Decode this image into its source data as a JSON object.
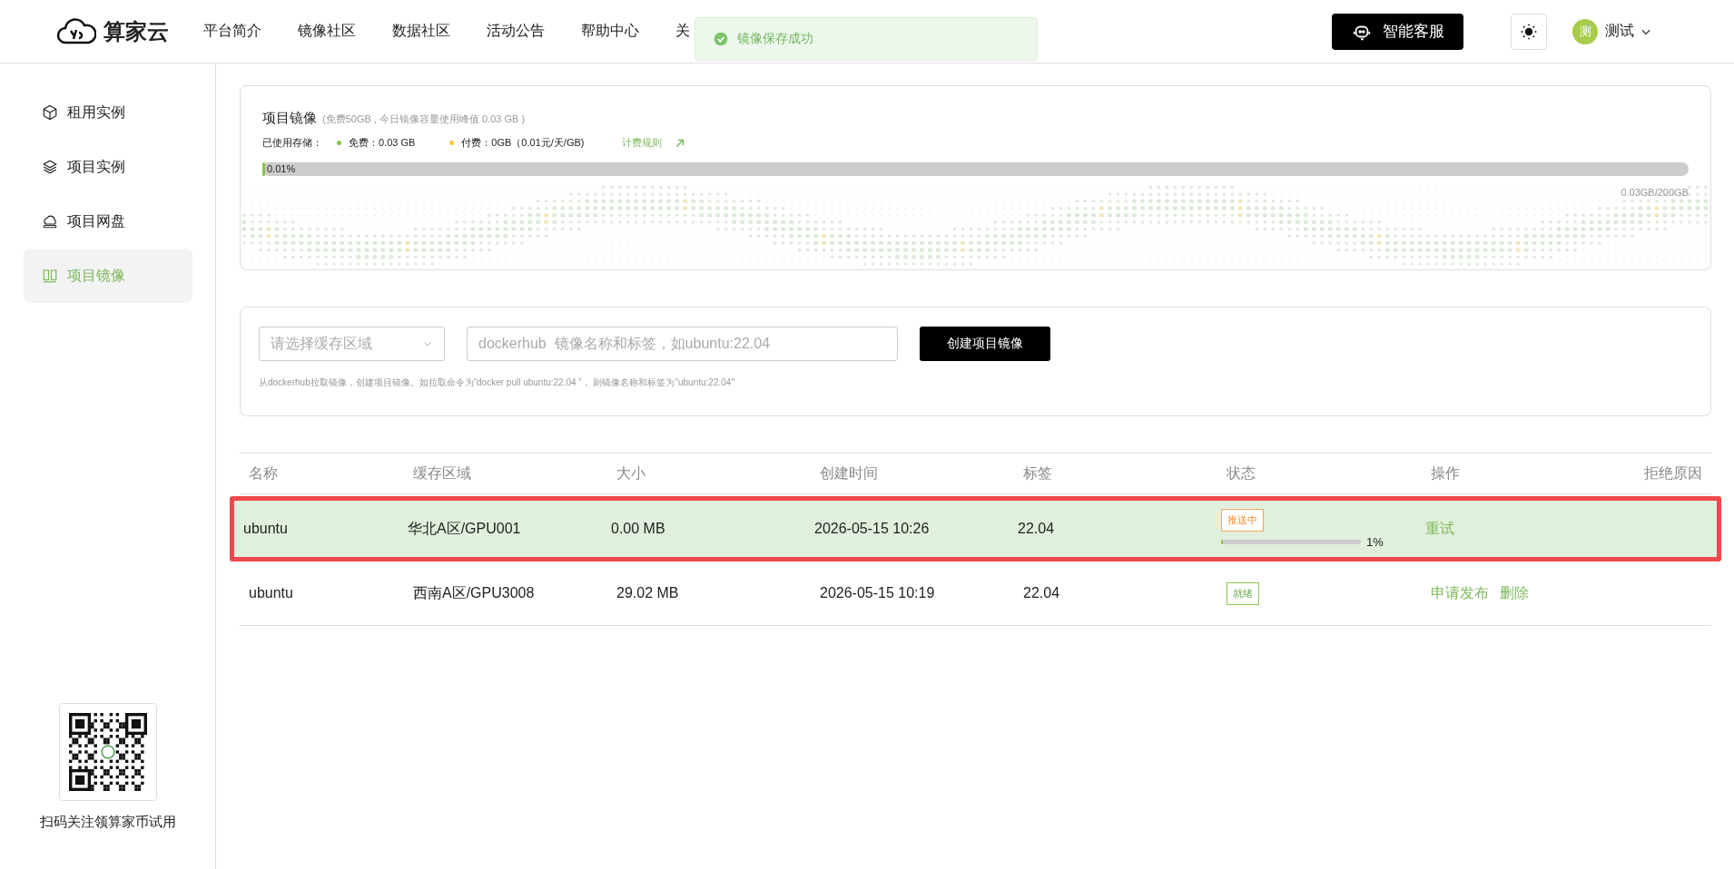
{
  "header": {
    "logo": "算家云",
    "nav": [
      {
        "label": "平台简介"
      },
      {
        "label": "镜像社区"
      },
      {
        "label": "数据社区"
      },
      {
        "label": "活动公告"
      },
      {
        "label": "帮助中心"
      },
      {
        "label": "关"
      }
    ],
    "support_button": "智能客服",
    "user": {
      "avatar": "测",
      "name": "测试"
    }
  },
  "toast": {
    "message": "镜像保存成功"
  },
  "sidebar": {
    "items": [
      {
        "label": "租用实例",
        "kind": "box",
        "selected": false
      },
      {
        "label": "项目实例",
        "kind": "layers",
        "selected": false
      },
      {
        "label": "项目网盘",
        "kind": "disk",
        "selected": false
      },
      {
        "label": "项目镜像",
        "kind": "image",
        "selected": true
      }
    ],
    "qr_caption": "扫码关注领算家币试用"
  },
  "storage": {
    "title": "项目镜像",
    "subtitle": "(免费50GB , 今日镜像容量使用峰值 0.03 GB )",
    "used_label": "已使用存储：",
    "legend": [
      {
        "text": "免费：0.03 GB",
        "color": "#8bc34a"
      },
      {
        "text": "付费：0GB（0.01元/天/GB)",
        "color": "#f2cc3d"
      }
    ],
    "pricing_link": "计费规则",
    "level": 0.0001,
    "percent": "0.01%",
    "total": "0.03GB/200GB"
  },
  "create_form": {
    "region_placeholder": "请选择缓存区域",
    "name_placeholder": "dockerhub  镜像名称和标签，如ubuntu:22.04",
    "button": "创建项目镜像",
    "hint": "从dockerhub拉取镜像，创建项目镜像。如拉取命令为“docker pull ubuntu:22.04 ”， 则镜像名称和标签为\"ubuntu:22.04\""
  },
  "table": {
    "columns": [
      "名称",
      "缓存区域",
      "大小",
      "创建时间",
      "标签",
      "状态",
      "操作",
      "拒绝原因"
    ],
    "rows": [
      {
        "selected": true,
        "name": "ubuntu",
        "region": "华北A区/GPU001",
        "size": "0.00 MB",
        "created": "2026-05-15 10:26",
        "tag": "22.04",
        "status": {
          "label": "推送中",
          "kind": "pushing",
          "level": 0.01,
          "percent": "1%"
        },
        "actions": [
          "重试"
        ]
      },
      {
        "selected": false,
        "name": "ubuntu",
        "region": "西南A区/GPU3008",
        "size": "29.02 MB",
        "created": "2026-05-15 10:19",
        "tag": "22.04",
        "status": {
          "label": "就绪",
          "kind": "ready"
        },
        "actions": [
          "申请发布",
          "删除"
        ]
      }
    ]
  }
}
